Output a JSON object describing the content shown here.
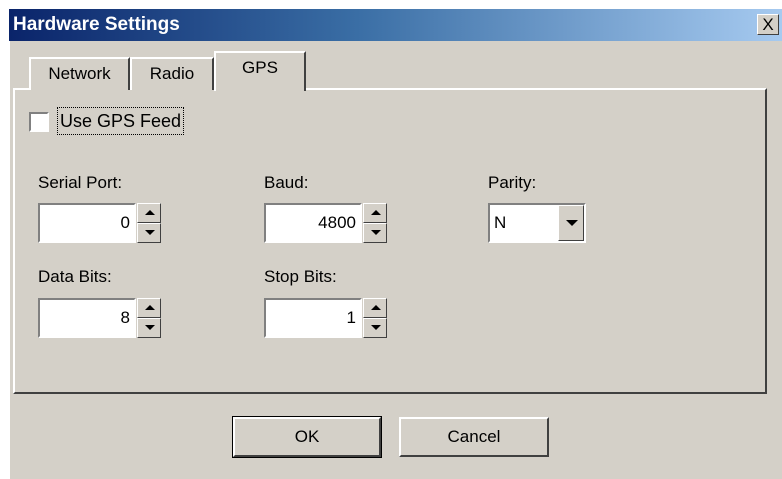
{
  "window": {
    "title": "Hardware Settings",
    "close_label": "X"
  },
  "tabs": [
    {
      "label": "Network",
      "active": false
    },
    {
      "label": "Radio",
      "active": false
    },
    {
      "label": "GPS",
      "active": true
    }
  ],
  "gps": {
    "use_feed": {
      "label": "Use GPS Feed",
      "checked": false
    },
    "serial_port": {
      "label": "Serial Port:",
      "value": "0"
    },
    "baud": {
      "label": "Baud:",
      "value": "4800"
    },
    "parity": {
      "label": "Parity:",
      "value": "N"
    },
    "data_bits": {
      "label": "Data Bits:",
      "value": "8"
    },
    "stop_bits": {
      "label": "Stop Bits:",
      "value": "1"
    }
  },
  "buttons": {
    "ok": "OK",
    "cancel": "Cancel"
  },
  "colors": {
    "face": "#d4d0c8",
    "title_start": "#0a246a",
    "title_end": "#a6caf0"
  },
  "icons": {
    "close": "close-icon",
    "spin_up": "spin-up-arrow-icon",
    "spin_down": "spin-down-arrow-icon",
    "dropdown": "chevron-down-icon"
  }
}
